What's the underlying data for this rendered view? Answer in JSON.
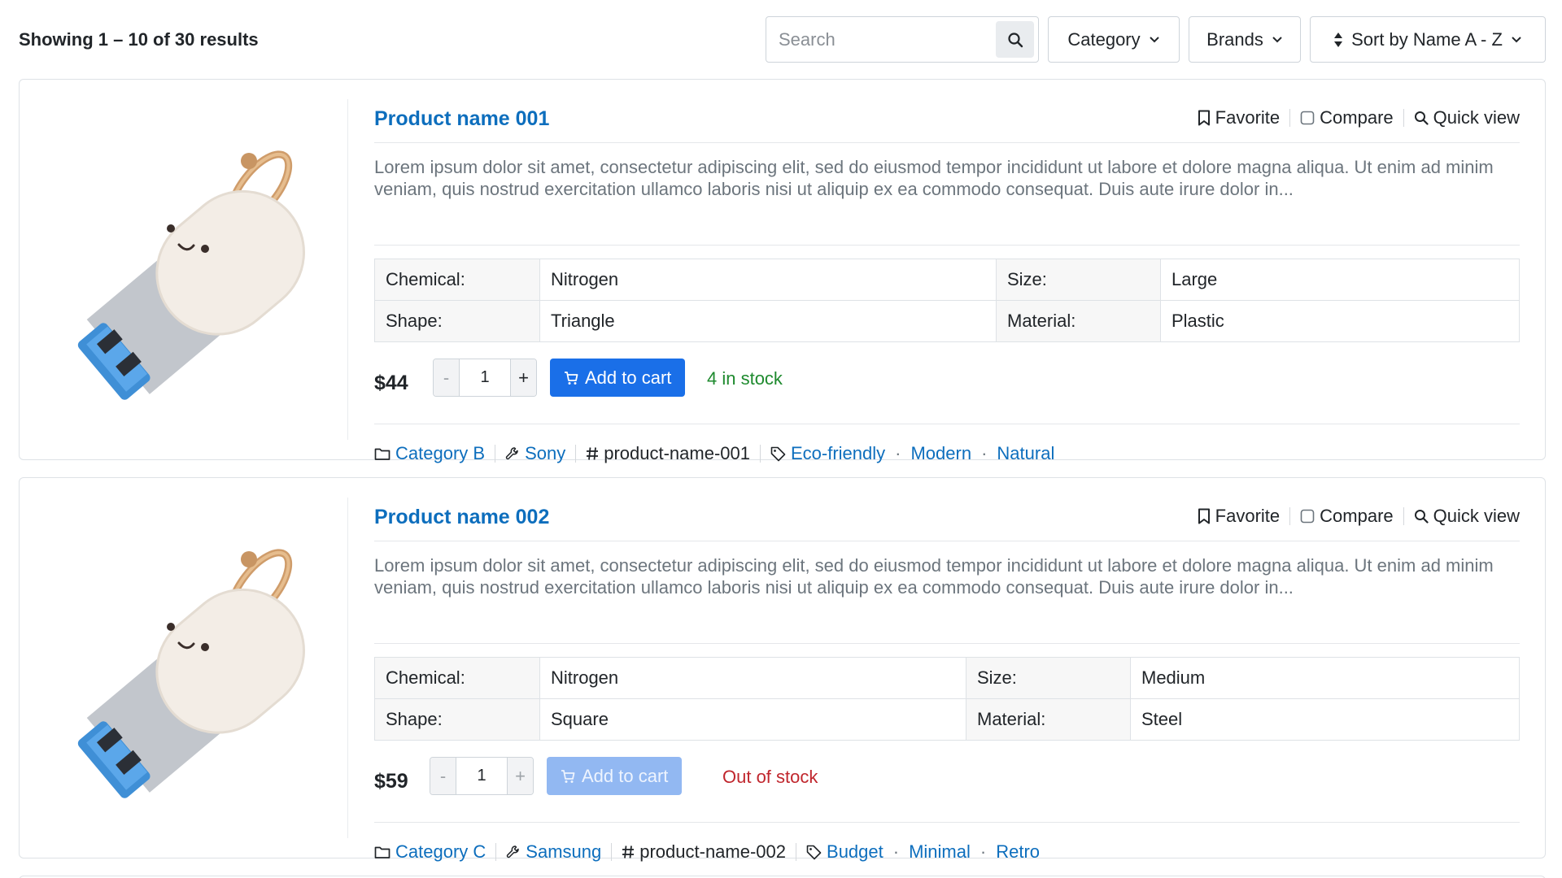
{
  "header": {
    "results_text": "Showing 1 – 10 of 30 results",
    "search_placeholder": "Search",
    "category_label": "Category",
    "brands_label": "Brands",
    "sort_label": "Sort by Name A - Z"
  },
  "actions": {
    "favorite": "Favorite",
    "compare": "Compare",
    "quick_view": "Quick view",
    "add_to_cart": "Add to cart"
  },
  "products": [
    {
      "name": "Product name 001",
      "description": "Lorem ipsum dolor sit amet, consectetur adipiscing elit, sed do eiusmod tempor incididunt ut labore et dolore magna aliqua. Ut enim ad minim veniam, quis nostrud exercitation ullamco laboris nisi ut aliquip ex ea commodo consequat. Duis aute irure dolor in...",
      "specs": {
        "chemical_label": "Chemical:",
        "chemical": "Nitrogen",
        "size_label": "Size:",
        "size": "Large",
        "shape_label": "Shape:",
        "shape": "Triangle",
        "material_label": "Material:",
        "material": "Plastic"
      },
      "price": "$44",
      "quantity": "1",
      "decrement": "-",
      "increment": "+",
      "stock": "4 in stock",
      "category": "Category B",
      "brand": "Sony",
      "slug": "product-name-001",
      "tags": [
        "Eco-friendly",
        "Modern",
        "Natural"
      ]
    },
    {
      "name": "Product name 002",
      "description": "Lorem ipsum dolor sit amet, consectetur adipiscing elit, sed do eiusmod tempor incididunt ut labore et dolore magna aliqua. Ut enim ad minim veniam, quis nostrud exercitation ullamco laboris nisi ut aliquip ex ea commodo consequat. Duis aute irure dolor in...",
      "specs": {
        "chemical_label": "Chemical:",
        "chemical": "Nitrogen",
        "size_label": "Size:",
        "size": "Medium",
        "shape_label": "Shape:",
        "shape": "Square",
        "material_label": "Material:",
        "material": "Steel"
      },
      "price": "$59",
      "quantity": "1",
      "decrement": "-",
      "increment": "+",
      "stock": "Out of stock",
      "category": "Category C",
      "brand": "Samsung",
      "slug": "product-name-002",
      "tags": [
        "Budget",
        "Minimal",
        "Retro"
      ]
    }
  ],
  "icons": {
    "search": "search-icon",
    "chevron": "chevron-down-icon",
    "sort": "sort-icon",
    "favorite": "bookmark-icon",
    "compare": "checkbox-icon",
    "quick_view": "search-icon",
    "cart": "cart-icon",
    "category": "folder-icon",
    "brand": "wrench-icon",
    "slug": "hash-icon",
    "tags": "tag-icon"
  },
  "colors": {
    "link": "#0d6ebd",
    "primary_button": "#1a6fe8",
    "disabled_button": "#92b8f2",
    "in_stock": "#1e8a2e",
    "out_of_stock": "#c0262d"
  }
}
